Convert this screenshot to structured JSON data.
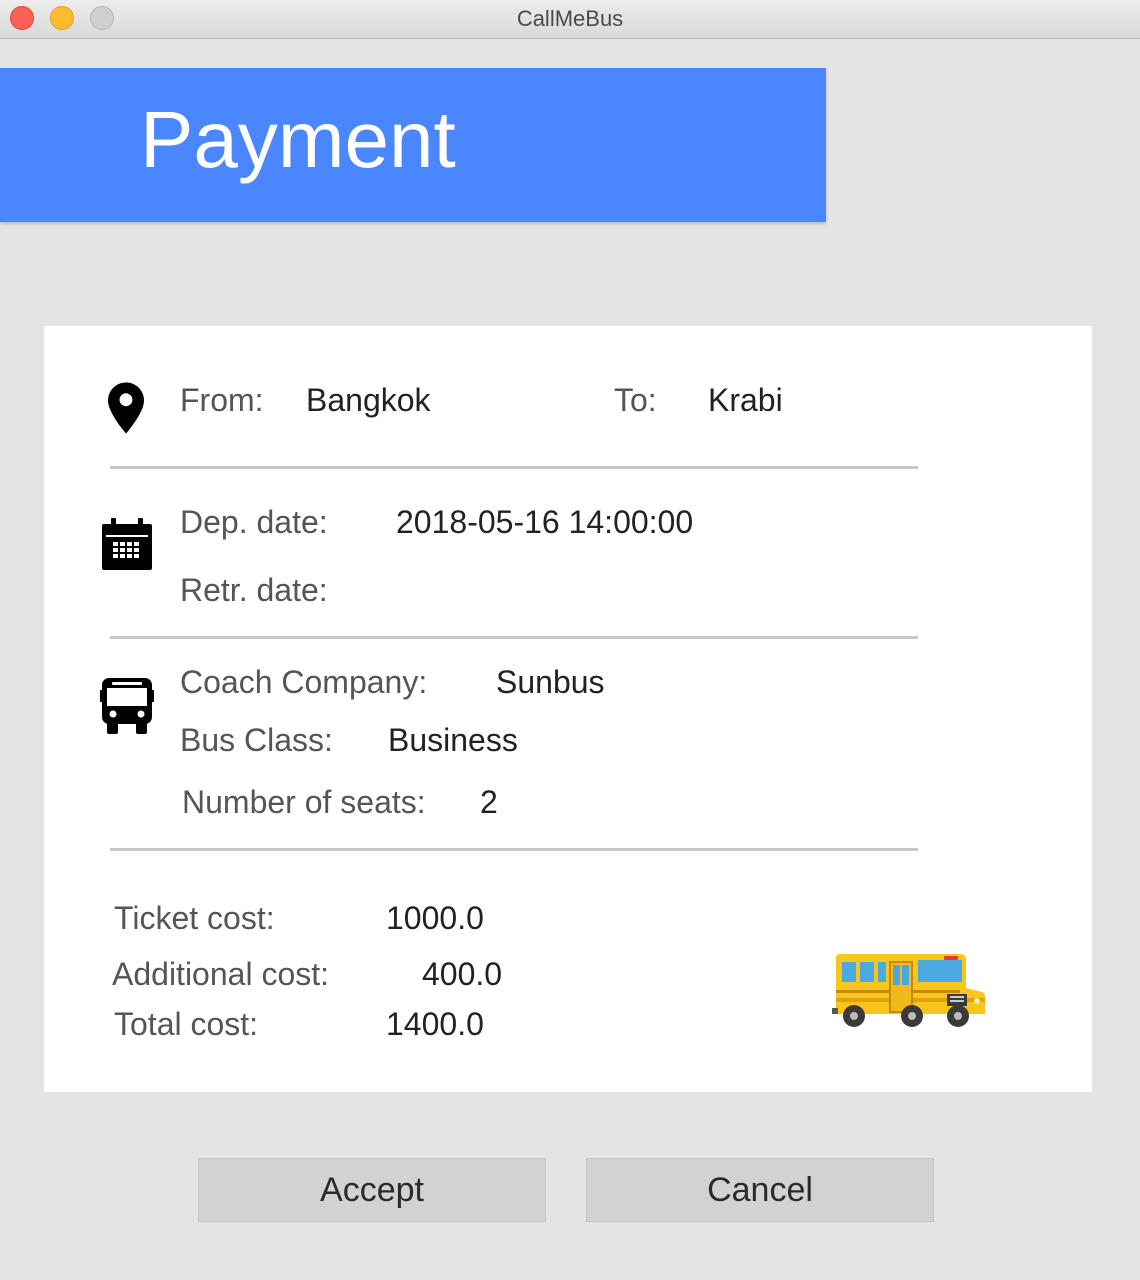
{
  "window": {
    "title": "CallMeBus"
  },
  "header": {
    "title": "Payment"
  },
  "route": {
    "from_label": "From:",
    "from_value": "Bangkok",
    "to_label": "To:",
    "to_value": "Krabi"
  },
  "dates": {
    "dep_label": "Dep. date:",
    "dep_value": "2018-05-16 14:00:00",
    "ret_label": "Retr. date:",
    "ret_value": ""
  },
  "bus": {
    "company_label": "Coach Company:",
    "company_value": "Sunbus",
    "class_label": "Bus Class:",
    "class_value": "Business",
    "seats_label": "Number of seats:",
    "seats_value": "2"
  },
  "costs": {
    "ticket_label": "Ticket cost:",
    "ticket_value": "1000.0",
    "additional_label": "Additional cost:",
    "additional_value": "400.0",
    "total_label": "Total cost:",
    "total_value": "1400.0"
  },
  "buttons": {
    "accept": "Accept",
    "cancel": "Cancel"
  },
  "icons": {
    "location": "map-pin-icon",
    "calendar": "calendar-icon",
    "bus": "bus-icon",
    "illustration": "school-bus-illustration"
  },
  "colors": {
    "header_bg": "#4a86fd",
    "page_bg": "#e4e4e4",
    "card_bg": "#ffffff",
    "button_bg": "#d2d2d2"
  }
}
